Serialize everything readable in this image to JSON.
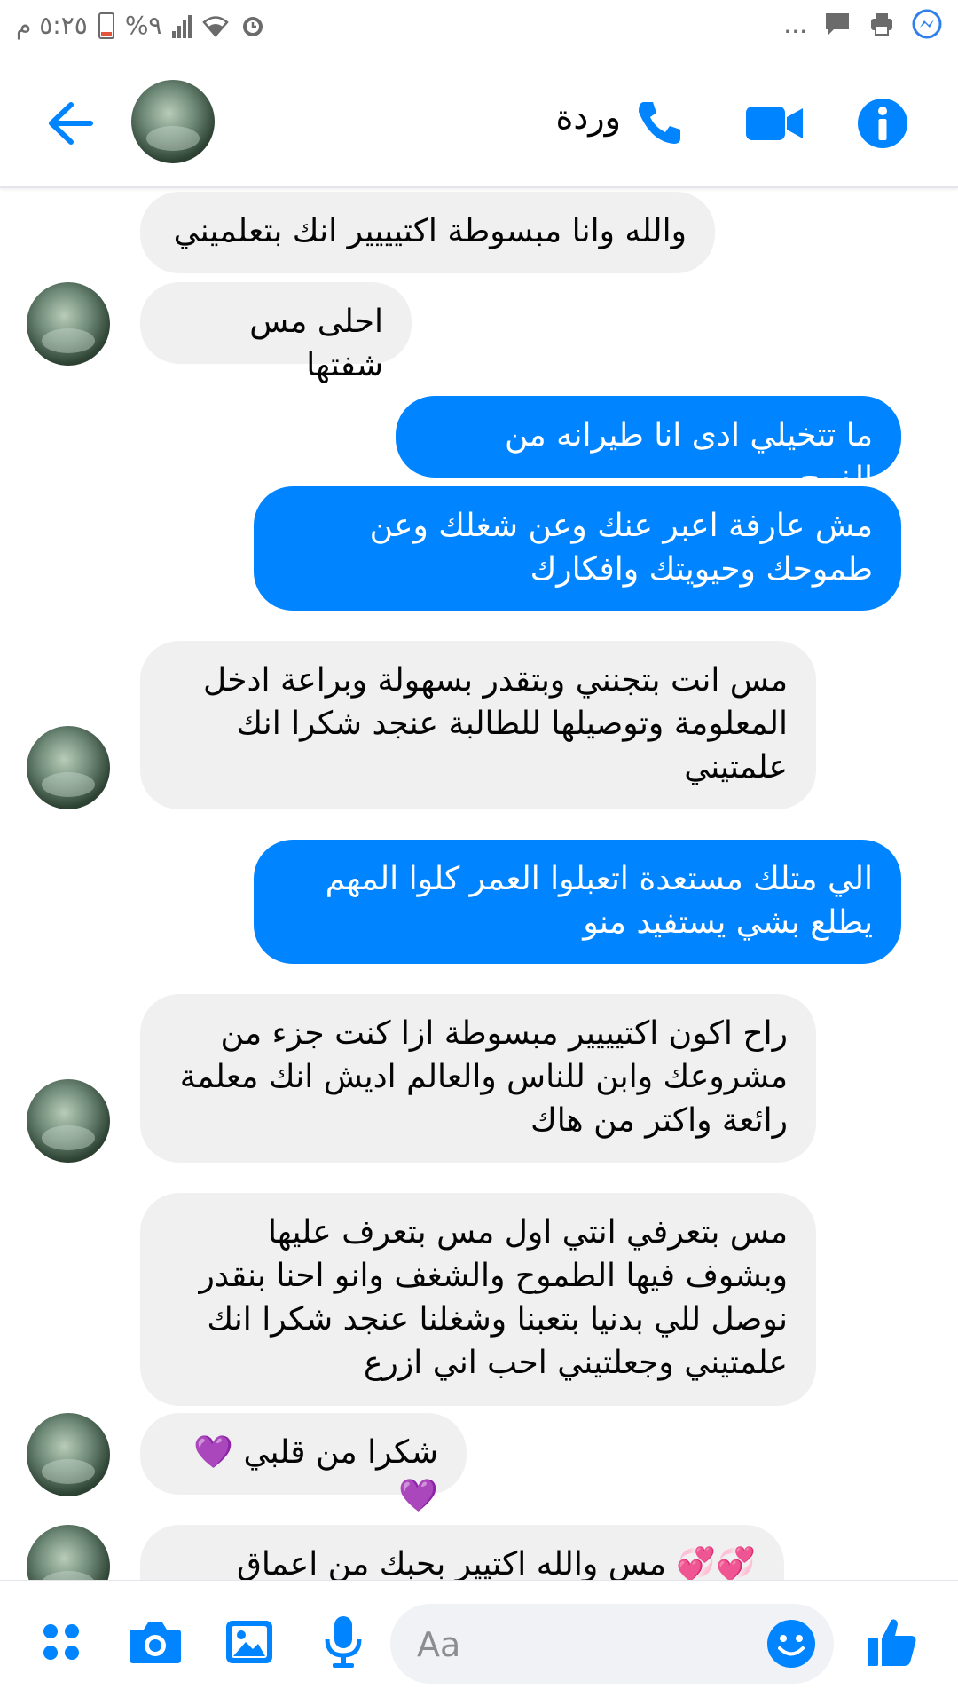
{
  "status_bar": {
    "time": "٥:٢٥ م",
    "battery_percent": "%٩",
    "overflow": "..."
  },
  "header": {
    "contact_name": "وردة"
  },
  "messages": [
    {
      "direction": "incoming",
      "text": "والله وانا مبسوطة اكتيييير انك بتعلميني"
    },
    {
      "direction": "incoming",
      "text": "احلى مس شفتها"
    },
    {
      "direction": "outgoing",
      "text": "ما تتخيلي ادى انا طيرانه من الفرح"
    },
    {
      "direction": "outgoing",
      "text": "مش عارفة اعبر عنك وعن شغلك وعن\nطموحك وحيويتك وافكارك"
    },
    {
      "direction": "incoming",
      "text": "مس انت بتجنني وبتقدر بسهولة وبراعة ادخل\nالمعلومة وتوصيلها للطالبة عنجد شكرا انك\nعلمتيني"
    },
    {
      "direction": "outgoing",
      "text": "الي متلك مستعدة اتعبلوا العمر كلوا المهم\nيطلع بشي يستفيد منو"
    },
    {
      "direction": "incoming",
      "text": "راح اكون اكتيييير مبسوطة ازا كنت جزء من\nمشروعك وابن للناس والعالم اديش انك معلمة\nرائعة واكتر من هاك"
    },
    {
      "direction": "incoming",
      "text": "مس بتعرفي انتي اول مس بتعرف عليها\nوبشوف فيها الطموح والشغف وانو احنا بنقدر\nنوصل للي بدنيا بتعبنا وشغلنا عنجد شكرا انك\nعلمتيني وجعلتيني احب اني ازرع"
    },
    {
      "direction": "incoming",
      "text": "شكرا من قلبي 💜💜"
    },
    {
      "direction": "incoming",
      "text": "💞💞 مس والله اكتيير بحبك من اعماق قلبي"
    }
  ],
  "composer": {
    "placeholder": "Aa"
  },
  "colors": {
    "accent": "#0084ff",
    "incoming_bubble": "#f0f0f0",
    "outgoing_bubble": "#0084ff"
  },
  "icons": [
    "alarm-icon",
    "wifi-icon",
    "signal-icon",
    "battery-icon",
    "messenger-notification-icon",
    "printer-icon",
    "chat-icon",
    "back-arrow-icon",
    "phone-icon",
    "video-camera-icon",
    "info-icon",
    "more-apps-icon",
    "camera-icon",
    "gallery-icon",
    "microphone-icon",
    "emoji-icon",
    "thumbs-up-icon"
  ]
}
